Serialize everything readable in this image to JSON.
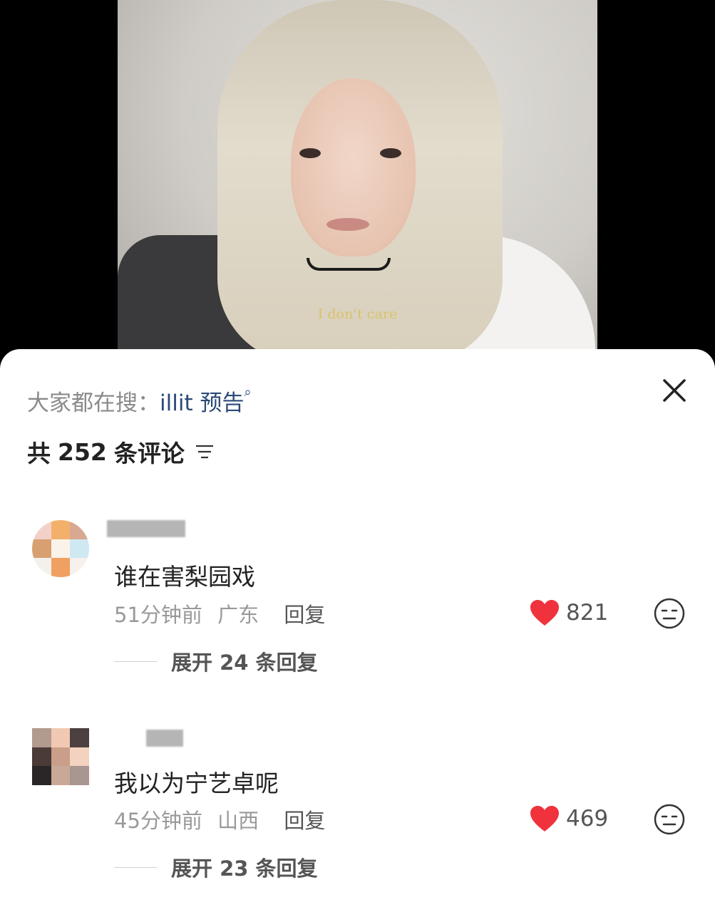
{
  "video": {
    "caption": "I don’t care"
  },
  "search_hint": {
    "prefix": "大家都在搜：",
    "keyword": "illit 预告"
  },
  "comments_header": {
    "prefix": "共",
    "count": "252",
    "suffix": "条评论"
  },
  "comments": [
    {
      "text": "谁在害梨园戏",
      "time": "51分钟前",
      "location": "广东",
      "reply_label": "回复",
      "likes": "821",
      "expand_label": "展开 24 条回复"
    },
    {
      "text": "我以为宁艺卓呢",
      "time": "45分钟前",
      "location": "山西",
      "reply_label": "回复",
      "likes": "469",
      "expand_label": "展开 23 条回复"
    }
  ],
  "colors": {
    "like": "#f0323c",
    "keyword": "#2c4a77"
  }
}
